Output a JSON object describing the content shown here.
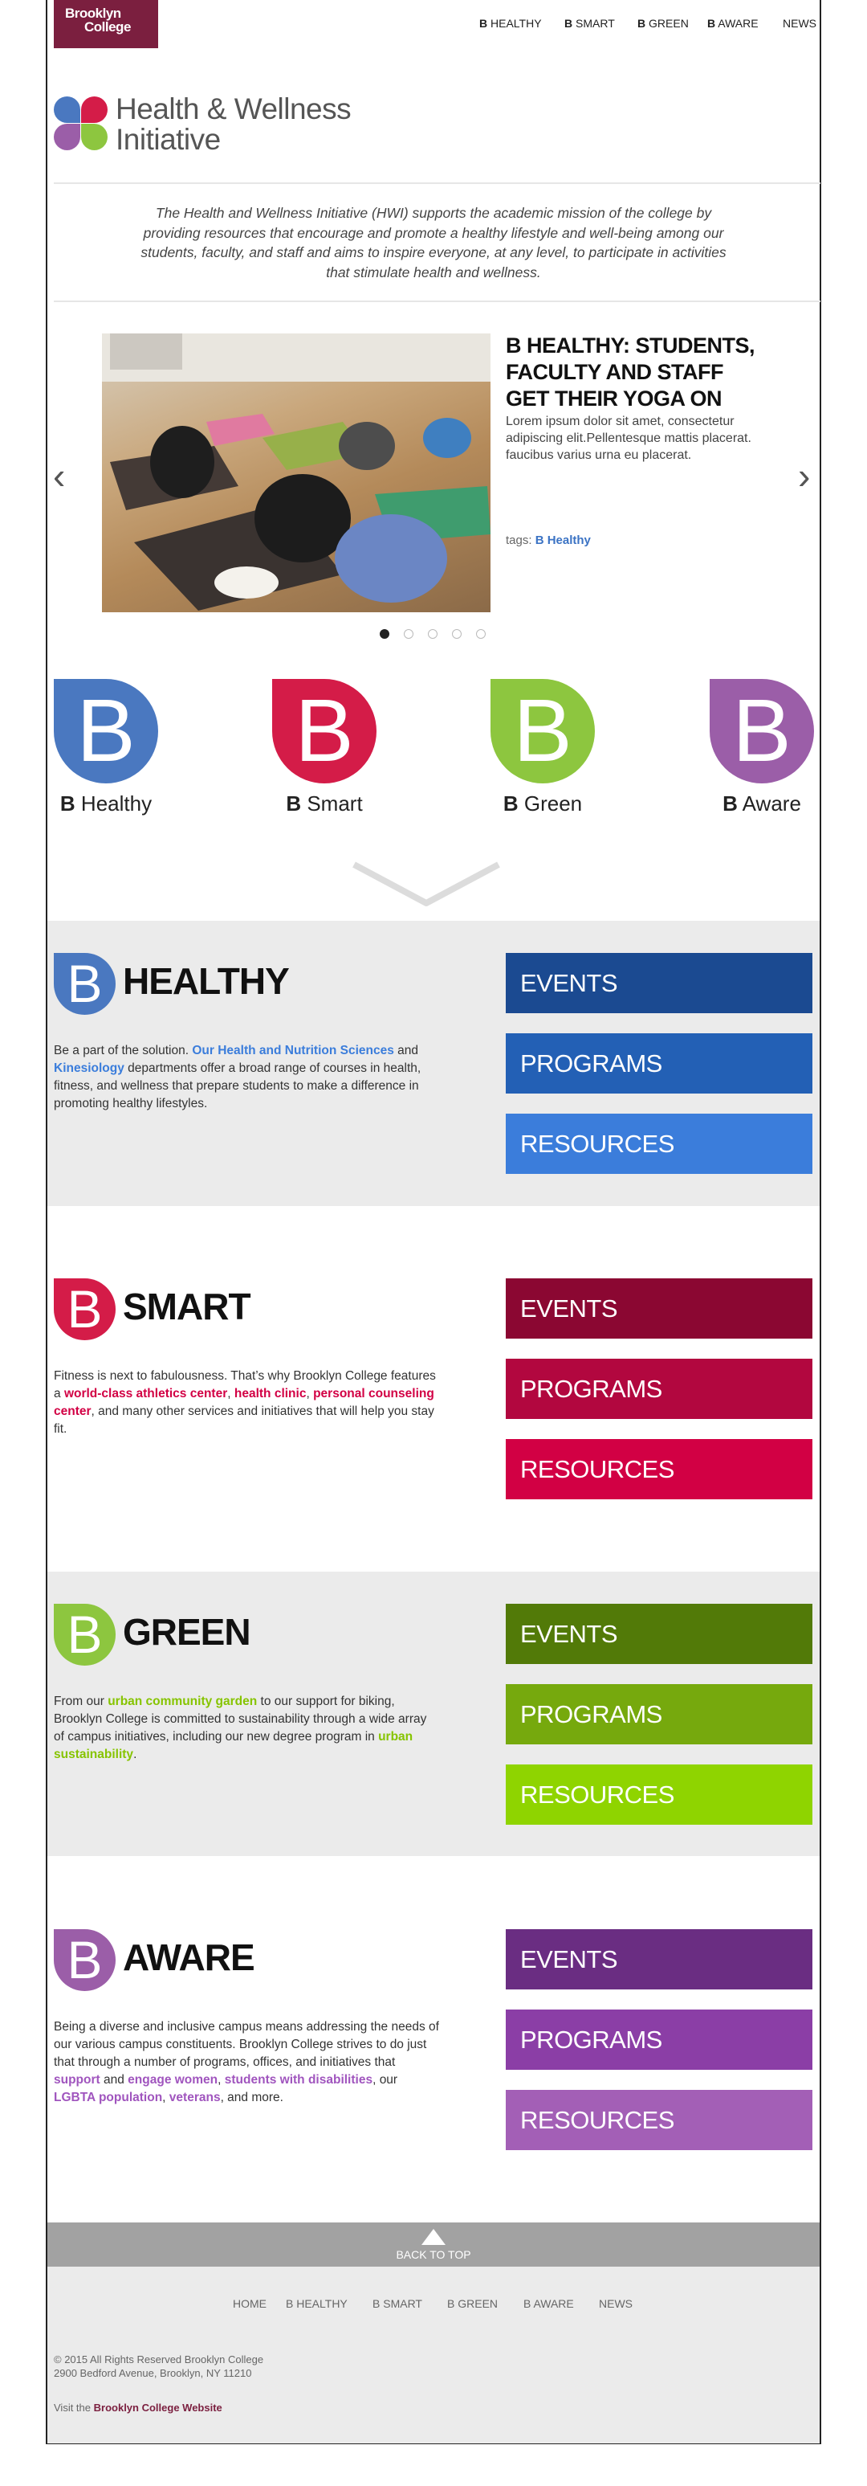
{
  "header": {
    "logo_line1": "Brooklyn",
    "logo_line2": "College",
    "nav": [
      {
        "b": "B",
        "label": "HEALTHY"
      },
      {
        "b": "B",
        "label": "SMART"
      },
      {
        "b": "B",
        "label": "GREEN"
      },
      {
        "b": "B",
        "label": "AWARE"
      },
      {
        "b": "",
        "label": "NEWS"
      }
    ]
  },
  "hwi": {
    "title_line1": "Health & Wellness",
    "title_line2": "Initiative",
    "petal_colors": [
      "#4a78c0",
      "#d41c48",
      "#9b5ea8",
      "#8dc63f"
    ],
    "intro": "The Health and Wellness Initiative (HWI) supports the academic mission of the college by providing resources that encourage and promote a healthy lifestyle and well-being among our students, faculty, and staff and aims to inspire everyone, at any level, to participate in activities that stimulate health and wellness."
  },
  "carousel": {
    "title": "B HEALTHY: STUDENTS, FACULTY AND STAFF GET THEIR YOGA ON",
    "text": "Lorem ipsum dolor sit amet, consectetur adipiscing elit.Pellentesque mattis placerat. faucibus varius urna eu placerat.",
    "tags_label": "tags:",
    "tag": "B Healthy",
    "prev_icon": "chevron-left-icon",
    "next_icon": "chevron-right-icon",
    "slide_count": 5,
    "active_slide": 1
  },
  "pillars": [
    {
      "letter": "B",
      "b": "B",
      "name": "Healthy",
      "color": "#4a78c0"
    },
    {
      "letter": "B",
      "b": "B",
      "name": "Smart",
      "color": "#d41c48"
    },
    {
      "letter": "B",
      "b": "B",
      "name": "Green",
      "color": "#8dc63f"
    },
    {
      "letter": "B",
      "b": "B",
      "name": "Aware",
      "color": "#9b5ea8"
    }
  ],
  "sections": [
    {
      "letter": "B",
      "title": "HEALTHY",
      "icon_color": "#4a78c0",
      "link_color": "#3b7ddb",
      "paragraph": [
        {
          "t": "Be a part of the solution. "
        },
        {
          "t": "Our Health and Nutrition Sciences",
          "link": true
        },
        {
          "t": " and "
        },
        {
          "t": "Kinesiology",
          "link": true
        },
        {
          "t": " departments offer a broad range of courses in health, fitness, and wellness that prepare students to make a difference in promoting healthy lifestyles."
        }
      ],
      "buttons": [
        {
          "label": "EVENTS",
          "color": "#1b4a91"
        },
        {
          "label": "PROGRAMS",
          "color": "#2360b5"
        },
        {
          "label": "RESOURCES",
          "color": "#3b7ddb"
        }
      ]
    },
    {
      "letter": "B",
      "title": "SMART",
      "icon_color": "#d41c48",
      "link_color": "#d20044",
      "paragraph": [
        {
          "t": "Fitness is next to fabulousness. That’s why Brooklyn College features a "
        },
        {
          "t": "world-class athletics center",
          "link": true
        },
        {
          "t": ", "
        },
        {
          "t": "health clinic",
          "link": true
        },
        {
          "t": ", "
        },
        {
          "t": "personal counseling center",
          "link": true
        },
        {
          "t": ", and many other services and initiatives that  will help you stay fit."
        }
      ],
      "buttons": [
        {
          "label": "EVENTS",
          "color": "#8b0732"
        },
        {
          "label": "PROGRAMS",
          "color": "#b2073f"
        },
        {
          "label": "RESOURCES",
          "color": "#d20044"
        }
      ]
    },
    {
      "letter": "B",
      "title": "GREEN",
      "icon_color": "#8dc63f",
      "link_color": "#86c400",
      "paragraph": [
        {
          "t": "From our "
        },
        {
          "t": "urban community garden",
          "link": true
        },
        {
          "t": " to our support for biking, Brooklyn College is committed to sustainability through a wide array of campus initiatives, including our new degree program in "
        },
        {
          "t": "urban sustainability",
          "link": true
        },
        {
          "t": "."
        }
      ],
      "buttons": [
        {
          "label": "EVENTS",
          "color": "#527a08"
        },
        {
          "label": "PROGRAMS",
          "color": "#76a90d"
        },
        {
          "label": "RESOURCES",
          "color": "#8fd400"
        }
      ]
    },
    {
      "letter": "B",
      "title": "AWARE",
      "icon_color": "#9b5ea8",
      "link_color": "#a055be",
      "paragraph": [
        {
          "t": "Being a diverse and inclusive campus means addressing the needs of our various campus constituents. Brooklyn College strives to do just that through a number of programs, offices, and initiatives that "
        },
        {
          "t": "support",
          "link": true
        },
        {
          "t": " and "
        },
        {
          "t": "engage women",
          "link": true
        },
        {
          "t": ", "
        },
        {
          "t": "students with disabilities",
          "link": true
        },
        {
          "t": ", our "
        },
        {
          "t": "LGBTA population",
          "link": true
        },
        {
          "t": ", "
        },
        {
          "t": "veterans",
          "link": true
        },
        {
          "t": ", and more."
        }
      ],
      "buttons": [
        {
          "label": "EVENTS",
          "color": "#6a2d82"
        },
        {
          "label": "PROGRAMS",
          "color": "#8b3ea6"
        },
        {
          "label": "RESOURCES",
          "color": "#a35fb6"
        }
      ]
    }
  ],
  "footer": {
    "back_to_top": "BACK TO TOP",
    "nav": [
      "HOME",
      "B HEALTHY",
      "B SMART",
      "B GREEN",
      "B AWARE",
      "NEWS"
    ],
    "copyright": "© 2015 All Rights Reserved Brooklyn College",
    "address": "2900 Bedford Avenue, Brooklyn, NY 11210",
    "visit_prefix": "Visit the",
    "visit_link": "Brooklyn College Website"
  }
}
